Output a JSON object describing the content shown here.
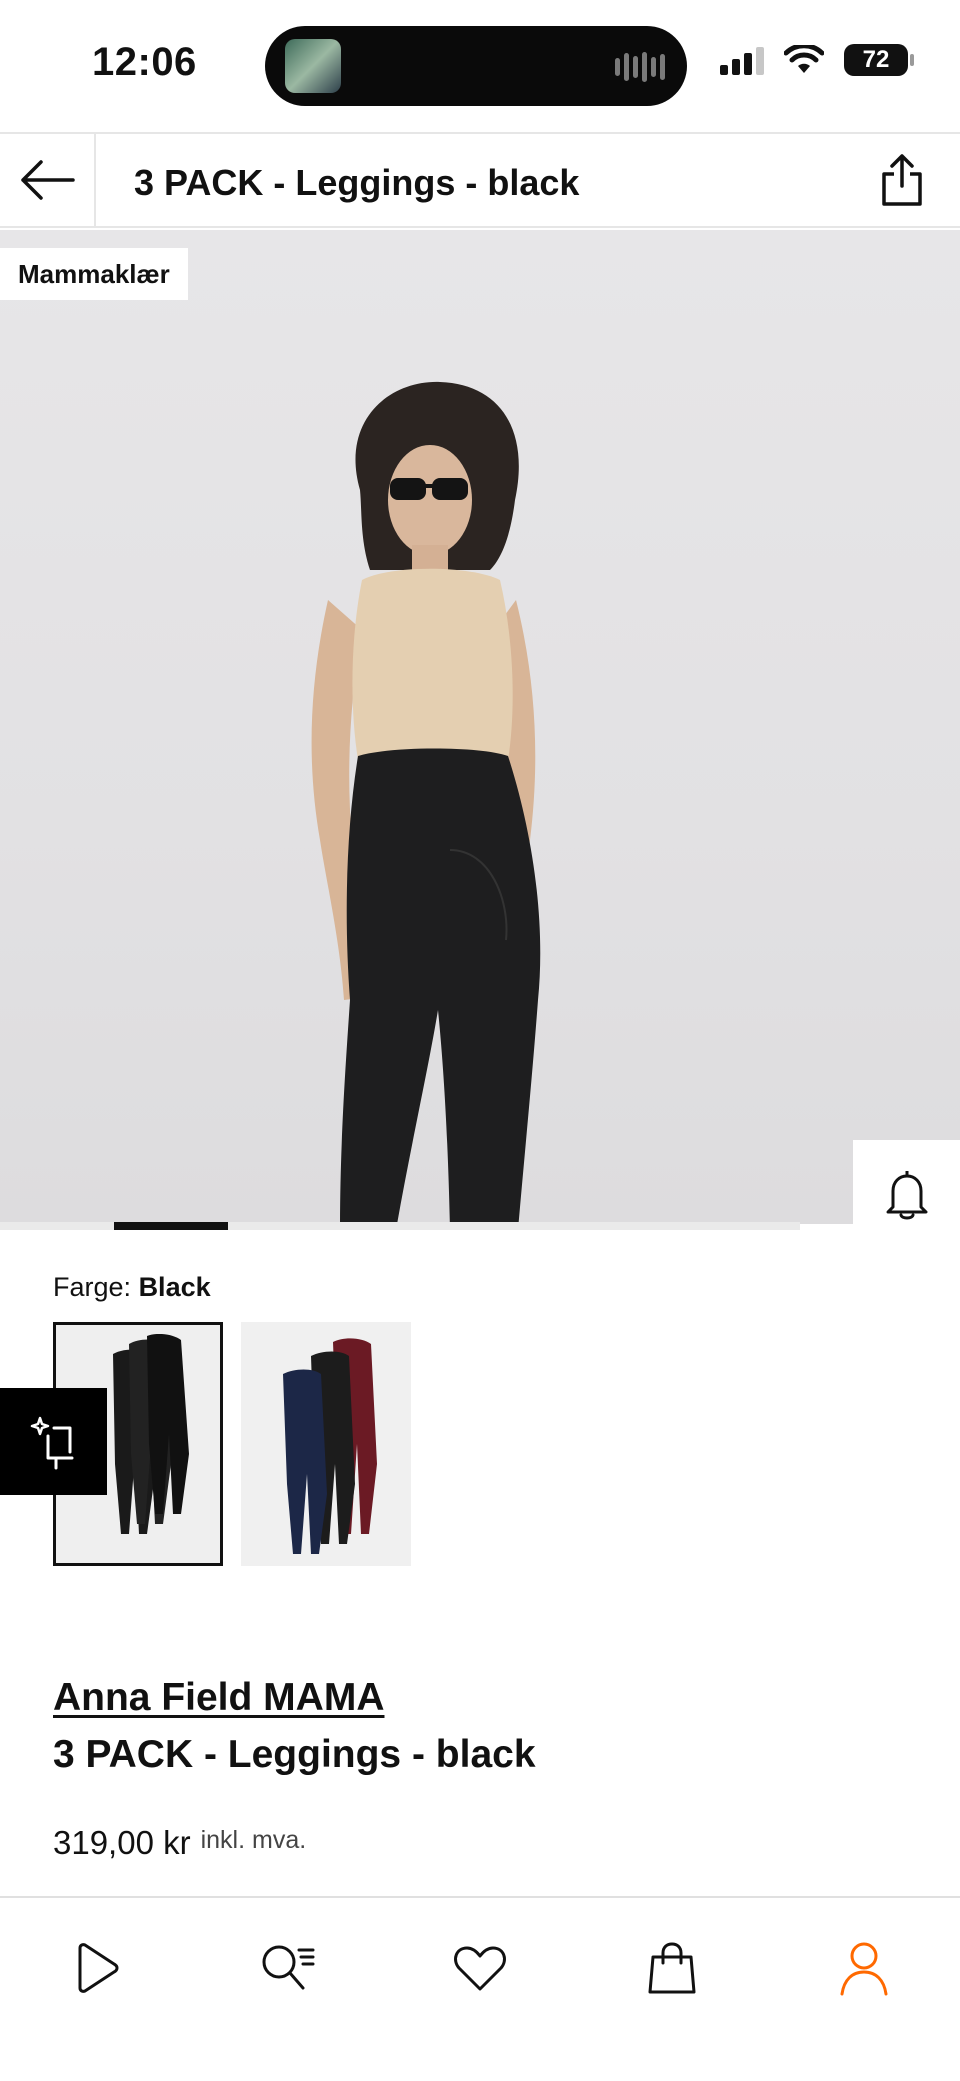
{
  "status_bar": {
    "time": "12:06",
    "battery": "72"
  },
  "header": {
    "title": "3 PACK - Leggings - black"
  },
  "hero": {
    "badge": "Mammaklær"
  },
  "color": {
    "label": "Farge:",
    "value": "Black"
  },
  "product": {
    "brand": "Anna Field MAMA",
    "name": "3 PACK - Leggings - black",
    "price": "319,00 kr",
    "vat_note": "inkl. mva."
  },
  "icons": {
    "back": "arrow-left-icon",
    "share": "share-icon",
    "notify": "bell-icon",
    "wishlist": "heart-icon",
    "bag": "shopping-bag-icon",
    "ai": "sparkle-crop-icon",
    "nav": [
      "play-icon",
      "search-list-icon",
      "heart-icon",
      "shopping-bag-icon",
      "user-icon"
    ]
  },
  "colors": {
    "accent": "#ff6900",
    "text": "#111111",
    "hero_bg": "#e3e2e4"
  }
}
